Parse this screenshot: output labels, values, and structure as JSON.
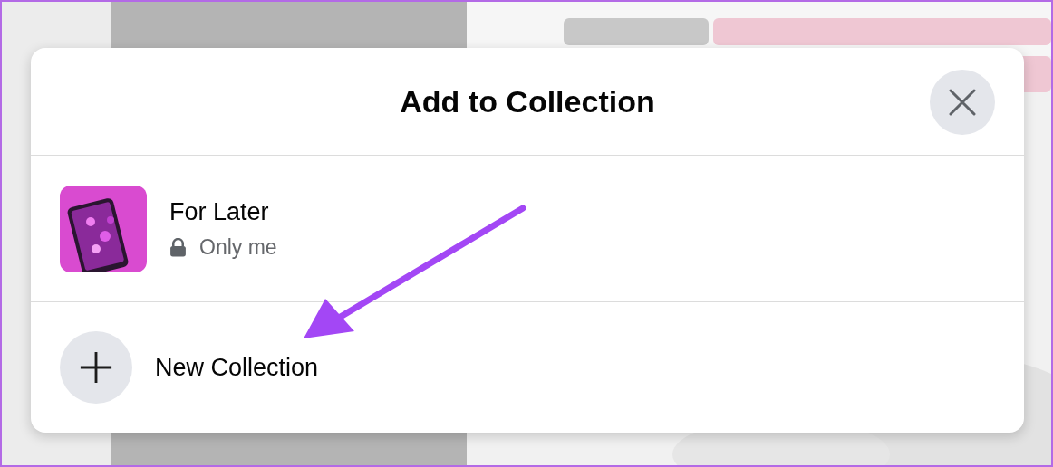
{
  "dialog": {
    "title": "Add to Collection",
    "collections": [
      {
        "name": "For Later",
        "privacy": "Only me"
      }
    ],
    "new_collection": {
      "label": "New Collection"
    }
  }
}
